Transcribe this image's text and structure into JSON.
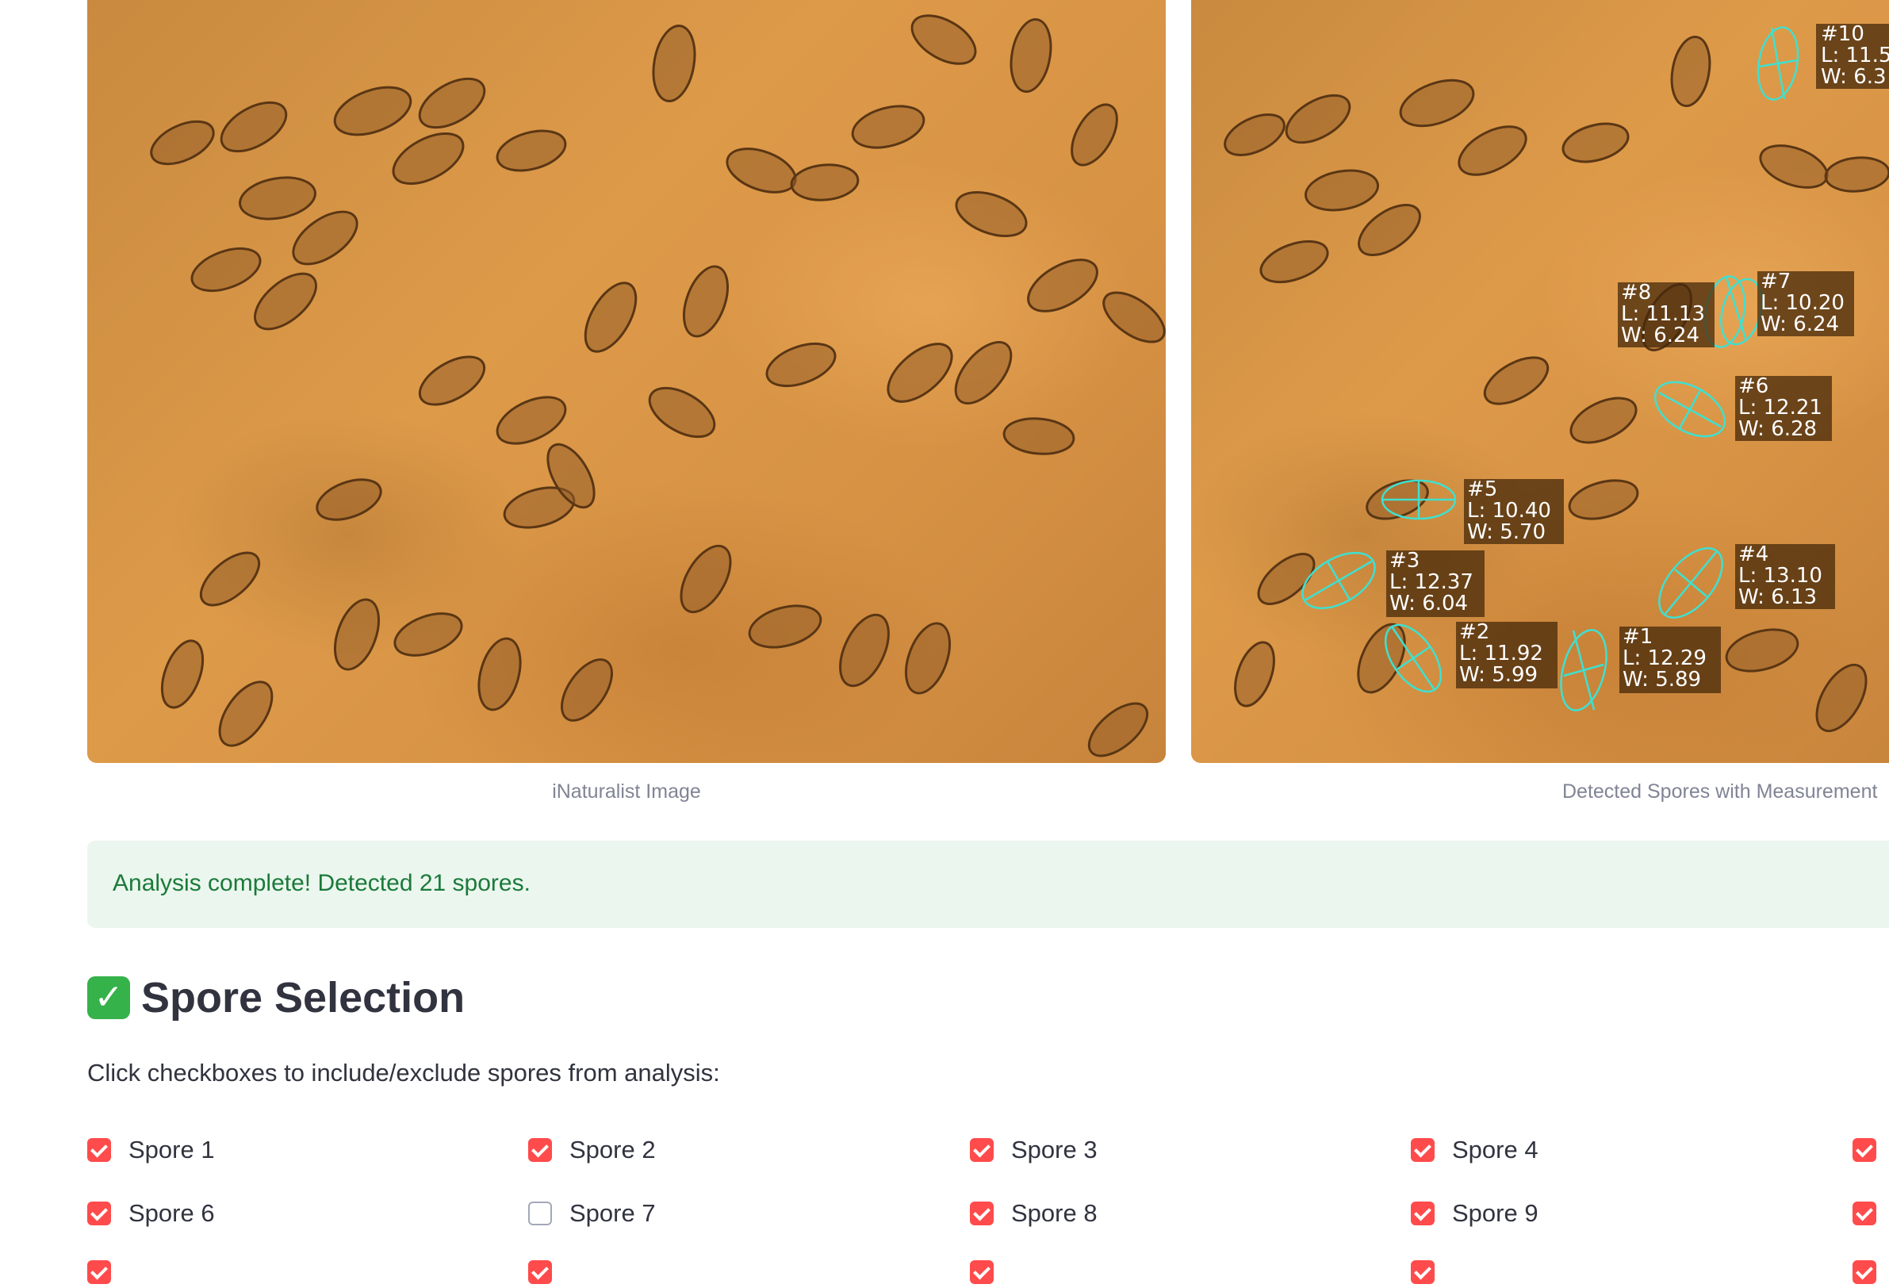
{
  "captions": {
    "left": "iNaturalist Image",
    "right": "Detected Spores with Measurement"
  },
  "annotations": [
    {
      "id": "#10",
      "length": "L: 11.5",
      "width": "W: 6.3"
    },
    {
      "id": "#8",
      "length": "L: 11.13",
      "width": "W: 6.24"
    },
    {
      "id": "#7",
      "length": "L: 10.20",
      "width": "W: 6.24"
    },
    {
      "id": "#6",
      "length": "L: 12.21",
      "width": "W: 6.28"
    },
    {
      "id": "#5",
      "length": "L: 10.40",
      "width": "W: 5.70"
    },
    {
      "id": "#3",
      "length": "L: 12.37",
      "width": "W: 6.04"
    },
    {
      "id": "#4",
      "length": "L: 13.10",
      "width": "W: 6.13"
    },
    {
      "id": "#2",
      "length": "L: 11.92",
      "width": "W: 5.99"
    },
    {
      "id": "#1",
      "length": "L: 12.29",
      "width": "W: 5.89"
    }
  ],
  "success_message": "Analysis complete! Detected 21 spores.",
  "section": {
    "icon": "check-mark-emoji-icon",
    "title": "Spore Selection",
    "instructions": "Click checkboxes to include/exclude spores from analysis:"
  },
  "checkboxes": [
    {
      "label": "Spore 1",
      "checked": true
    },
    {
      "label": "Spore 2",
      "checked": true
    },
    {
      "label": "Spore 3",
      "checked": true
    },
    {
      "label": "Spore 4",
      "checked": true
    },
    {
      "label": "",
      "checked": true
    },
    {
      "label": "Spore 6",
      "checked": true
    },
    {
      "label": "Spore 7",
      "checked": false
    },
    {
      "label": "Spore 8",
      "checked": true
    },
    {
      "label": "Spore 9",
      "checked": true
    },
    {
      "label": "",
      "checked": true
    }
  ],
  "colors": {
    "accent": "#ff4b4b",
    "annotation": "#3fe0d0",
    "success_bg": "#ebf6ee",
    "success_text": "#1b7a3a"
  }
}
